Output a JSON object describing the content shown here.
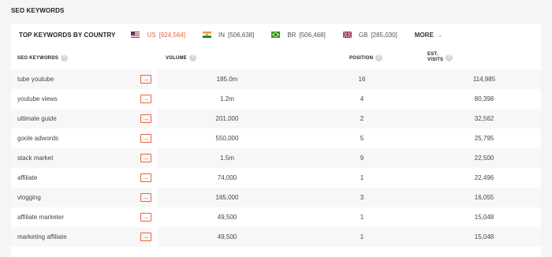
{
  "section_title": "SEO KEYWORDS",
  "country_bar": {
    "title": "TOP KEYWORDS BY COUNTRY",
    "countries": [
      {
        "code": "US",
        "count": "[924,564]",
        "active": true
      },
      {
        "code": "IN",
        "count": "[506,638]",
        "active": false
      },
      {
        "code": "BR",
        "count": "[506,468]",
        "active": false
      },
      {
        "code": "GB",
        "count": "[285,030]",
        "active": false
      }
    ],
    "more_label": "MORE",
    "more_icon": "chevron-down-icon"
  },
  "table": {
    "headers": {
      "keywords": "SEO KEYWORDS",
      "volume": "VOLUME",
      "position": "POSITION",
      "visits_line1": "EST.",
      "visits_line2": "VISITS"
    },
    "rows": [
      {
        "keyword": "tube youtube",
        "volume": "185.0m",
        "position": "16",
        "visits": "114,985"
      },
      {
        "keyword": "youtube views",
        "volume": "1.2m",
        "position": "4",
        "visits": "80,398"
      },
      {
        "keyword": "ultimate guide",
        "volume": "201,000",
        "position": "2",
        "visits": "32,562"
      },
      {
        "keyword": "goole adwords",
        "volume": "550,000",
        "position": "5",
        "visits": "25,795"
      },
      {
        "keyword": "stack market",
        "volume": "1.5m",
        "position": "9",
        "visits": "22,500"
      },
      {
        "keyword": "affiliate",
        "volume": "74,000",
        "position": "1",
        "visits": "22,496"
      },
      {
        "keyword": "vlogging",
        "volume": "165,000",
        "position": "3",
        "visits": "16,055"
      },
      {
        "keyword": "affiliate marketer",
        "volume": "49,500",
        "position": "1",
        "visits": "15,048"
      },
      {
        "keyword": "marketing affiliate",
        "volume": "49,500",
        "position": "1",
        "visits": "15,048"
      }
    ]
  },
  "colors": {
    "accent": "#e8643c",
    "row_alt": "#f7f7f7"
  }
}
